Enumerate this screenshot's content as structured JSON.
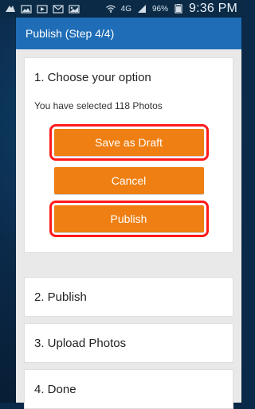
{
  "status_bar": {
    "network": "4G",
    "battery_percent": "96%",
    "time": "9:36 PM"
  },
  "title_bar": {
    "title": "Publish (Step 4/4)"
  },
  "step1": {
    "title": "1. Choose your option",
    "selected_text": "You have selected 118 Photos",
    "buttons": {
      "save_draft": "Save as Draft",
      "cancel": "Cancel",
      "publish": "Publish"
    }
  },
  "steps": [
    {
      "label": "2. Publish"
    },
    {
      "label": "3. Upload Photos"
    },
    {
      "label": "4. Done"
    }
  ],
  "colors": {
    "accent_blue": "#1f6db6",
    "button_orange": "#ef7f12",
    "highlight_red": "#ff1a1a",
    "background_gray": "#e9e9e9"
  }
}
